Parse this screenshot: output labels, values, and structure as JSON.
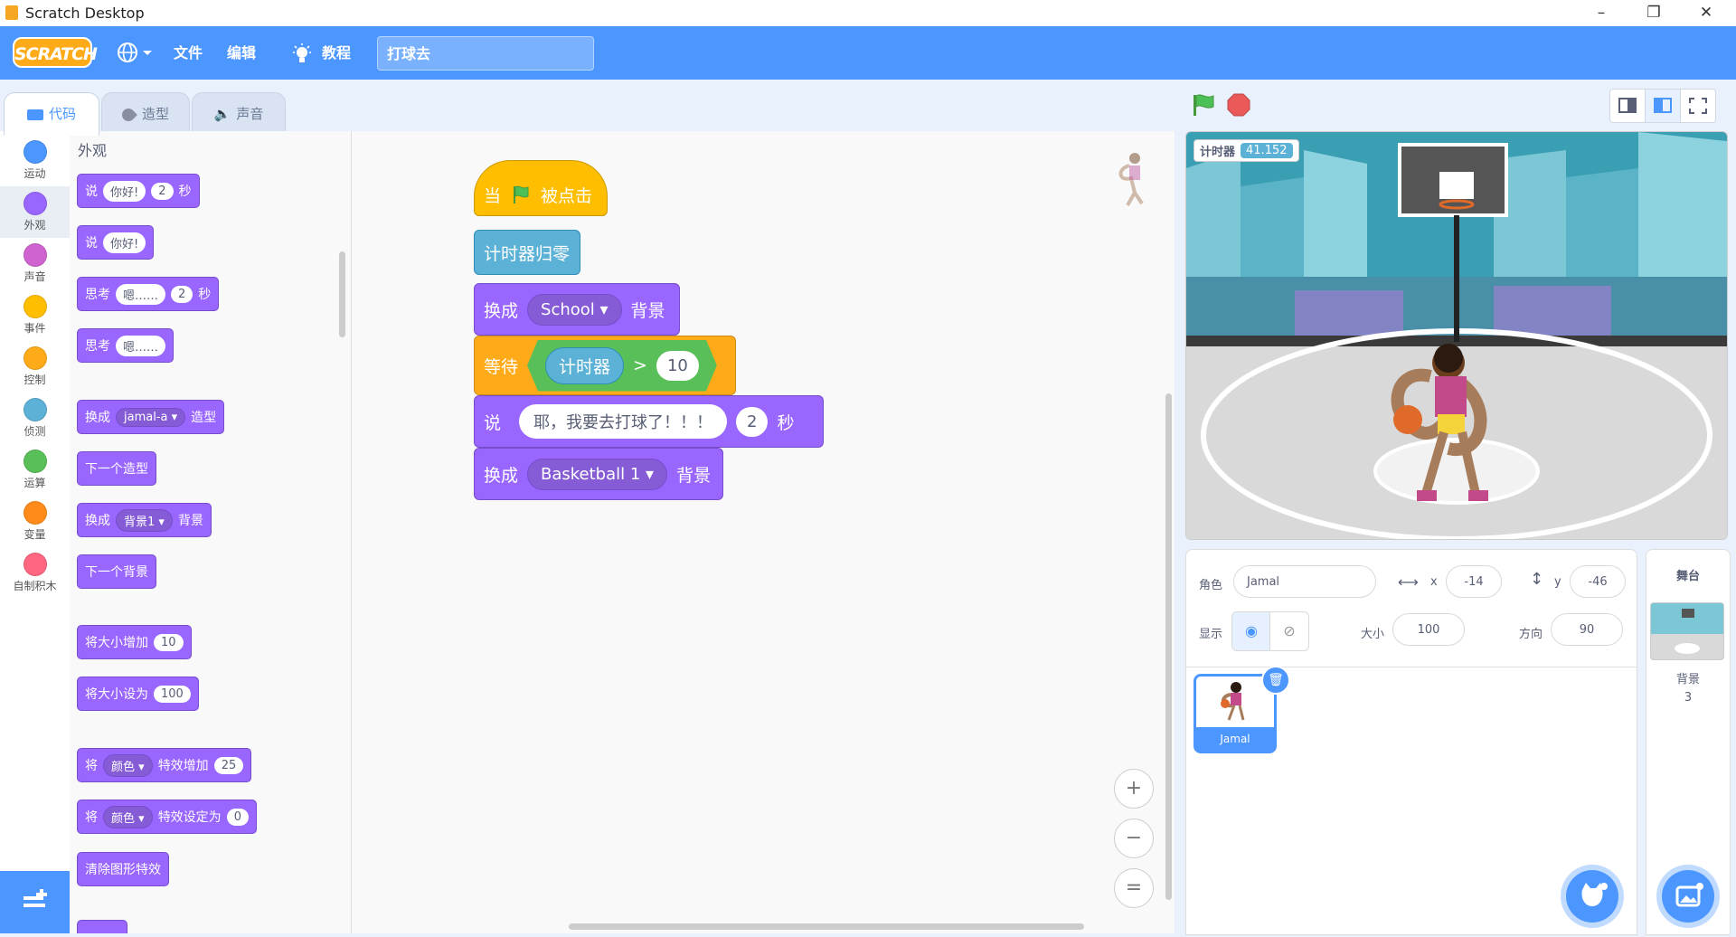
{
  "window": {
    "title": "Scratch Desktop",
    "minimize": "–",
    "restore": "❐",
    "close": "✕"
  },
  "menubar": {
    "logo": "SCRATCH",
    "file": "文件",
    "edit": "编辑",
    "tutorials": "教程",
    "project_title": "打球去"
  },
  "tabs": [
    {
      "label": "代码"
    },
    {
      "label": "造型"
    },
    {
      "label": "声音"
    }
  ],
  "categories": [
    {
      "label": "运动",
      "color": "#4c97ff"
    },
    {
      "label": "外观",
      "color": "#9966ff"
    },
    {
      "label": "声音",
      "color": "#cf63cf"
    },
    {
      "label": "事件",
      "color": "#ffbf00"
    },
    {
      "label": "控制",
      "color": "#ffab19"
    },
    {
      "label": "侦测",
      "color": "#5cb1d6"
    },
    {
      "label": "运算",
      "color": "#59c059"
    },
    {
      "label": "变量",
      "color": "#ff8c1a"
    },
    {
      "label": "自制积木",
      "color": "#ff6680"
    }
  ],
  "palette": {
    "heading": "外观",
    "say_secs": {
      "a": "说",
      "msg": "你好!",
      "secs": "2",
      "unit": "秒"
    },
    "say": {
      "a": "说",
      "msg": "你好!"
    },
    "think_secs": {
      "a": "思考",
      "msg": "嗯……",
      "secs": "2",
      "unit": "秒"
    },
    "think": {
      "a": "思考",
      "msg": "嗯……"
    },
    "switch_costume": {
      "a": "换成",
      "dd": "jamal-a",
      "b": "造型"
    },
    "next_costume": "下一个造型",
    "switch_backdrop": {
      "a": "换成",
      "dd": "背景1",
      "b": "背景"
    },
    "next_backdrop": "下一个背景",
    "change_size": {
      "a": "将大小增加",
      "v": "10"
    },
    "set_size": {
      "a": "将大小设为",
      "v": "100"
    },
    "change_effect": {
      "a": "将",
      "dd": "颜色",
      "b": "特效增加",
      "v": "25"
    },
    "set_effect": {
      "a": "将",
      "dd": "颜色",
      "b": "特效设定为",
      "v": "0"
    },
    "clear_effects": "清除图形特效"
  },
  "script": {
    "hat": {
      "a": "当",
      "b": "被点击"
    },
    "reset_timer": "计时器归零",
    "switch1": {
      "a": "换成",
      "dd": "School",
      "b": "背景"
    },
    "wait_until": {
      "a": "等待",
      "reporter": "计时器",
      "op": ">",
      "v": "10"
    },
    "say": {
      "a": "说",
      "msg": "耶，我要去打球了！！！",
      "secs": "2",
      "unit": "秒"
    },
    "switch2": {
      "a": "换成",
      "dd": "Basketball 1",
      "b": "背景"
    }
  },
  "zoom": {
    "in": "+",
    "out": "−",
    "reset": "="
  },
  "stage": {
    "timer_label": "计时器",
    "timer_value": "41.152"
  },
  "sprite_info": {
    "sprite_label": "角色",
    "sprite_name": "Jamal",
    "x_label": "x",
    "x": "-14",
    "y_label": "y",
    "y": "-46",
    "show_label": "显示",
    "size_label": "大小",
    "size": "100",
    "direction_label": "方向",
    "direction": "90"
  },
  "sprites": [
    {
      "name": "Jamal"
    }
  ],
  "stage_pane": {
    "title": "舞台",
    "backdrops_label": "背景",
    "backdrops_count": "3"
  }
}
